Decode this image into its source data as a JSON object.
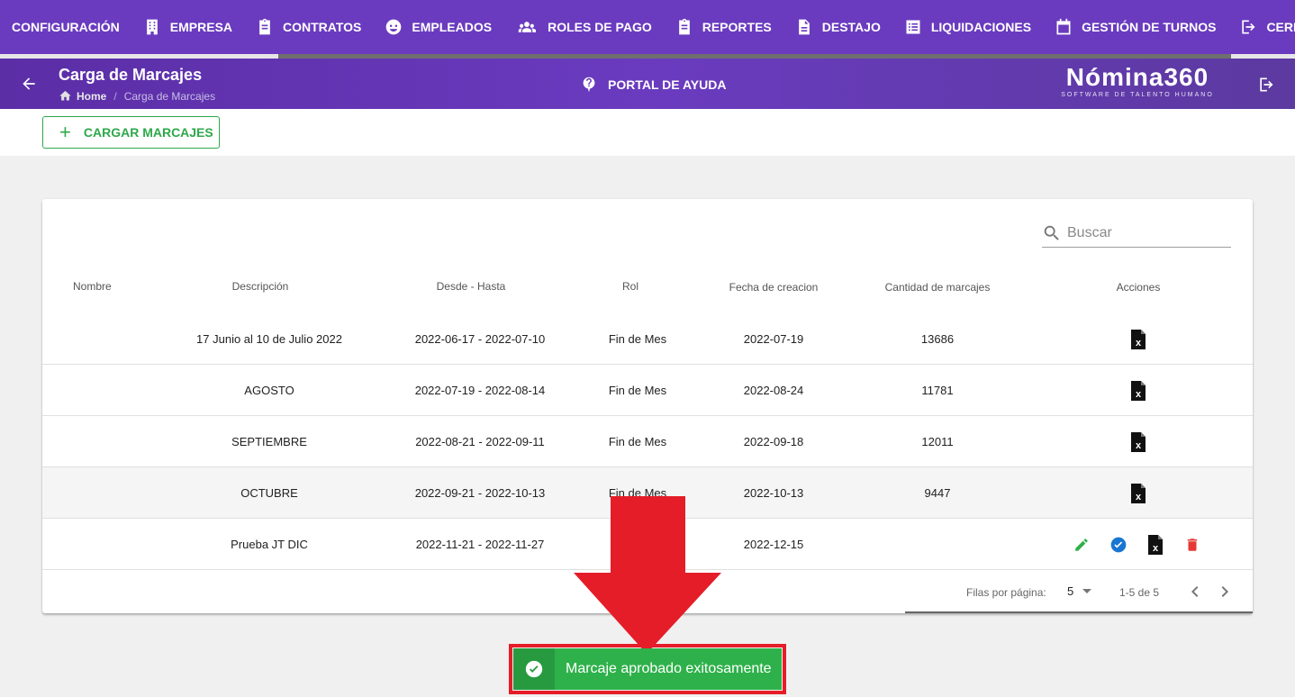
{
  "nav": {
    "items": [
      {
        "label": "CONFIGURACIÓN",
        "icon": ""
      },
      {
        "label": "EMPRESA",
        "icon": "building-icon"
      },
      {
        "label": "CONTRATOS",
        "icon": "clipboard-icon"
      },
      {
        "label": "EMPLEADOS",
        "icon": "face-icon"
      },
      {
        "label": "ROLES DE PAGO",
        "icon": "group-icon"
      },
      {
        "label": "REPORTES",
        "icon": "clipboard-icon"
      },
      {
        "label": "DESTAJO",
        "icon": "document-icon"
      },
      {
        "label": "LIQUIDACIONES",
        "icon": "list-icon"
      },
      {
        "label": "GESTIÓN DE TURNOS",
        "icon": "calendar-icon"
      },
      {
        "label": "CERRA",
        "icon": "logout-icon"
      }
    ]
  },
  "header": {
    "title": "Carga de Marcajes",
    "breadcrumb_home": "Home",
    "breadcrumb_sep": "/",
    "breadcrumb_current": "Carga de Marcajes",
    "help_label": "PORTAL DE AYUDA",
    "logo_main": "Nómina360",
    "logo_sub": "SOFTWARE DE TALENTO HUMANO"
  },
  "toolbar": {
    "plus": "+",
    "load_label": "CARGAR MARCAJES"
  },
  "search": {
    "placeholder": "Buscar"
  },
  "table": {
    "columns": [
      "Nombre",
      "Descripción",
      "Desde - Hasta",
      "Rol",
      "Fecha de creacion",
      "Cantidad de marcajes",
      "Acciones"
    ],
    "rows": [
      {
        "nombre": "",
        "descripcion": "17 Junio al 10 de Julio 2022",
        "rango": "2022-06-17 - 2022-07-10",
        "rol": "Fin de Mes",
        "fecha": "2022-07-19",
        "cantidad": "13686"
      },
      {
        "nombre": "",
        "descripcion": "AGOSTO",
        "rango": "2022-07-19 - 2022-08-14",
        "rol": "Fin de Mes",
        "fecha": "2022-08-24",
        "cantidad": "11781"
      },
      {
        "nombre": "",
        "descripcion": "SEPTIEMBRE",
        "rango": "2022-08-21 - 2022-09-11",
        "rol": "Fin de Mes",
        "fecha": "2022-09-18",
        "cantidad": "12011"
      },
      {
        "nombre": "",
        "descripcion": "OCTUBRE",
        "rango": "2022-09-21 - 2022-10-13",
        "rol": "Fin de Mes",
        "fecha": "2022-10-13",
        "cantidad": "9447"
      },
      {
        "nombre": "",
        "descripcion": "Prueba JT DIC",
        "rango": "2022-11-21 - 2022-11-27",
        "rol": "",
        "fecha": "2022-12-15",
        "cantidad": ""
      }
    ]
  },
  "pagination": {
    "rows_label": "Filas por página:",
    "rows_value": "5",
    "range": "1-5 de 5"
  },
  "snackbar": {
    "message": "Marcaje aprobado exitosamente"
  },
  "colors": {
    "nav_bg": "#6a3bbf",
    "success": "#2eb14a",
    "highlight": "#e41d28",
    "edit": "#2eb14a",
    "approve": "#1976d2",
    "delete": "#e53935"
  }
}
